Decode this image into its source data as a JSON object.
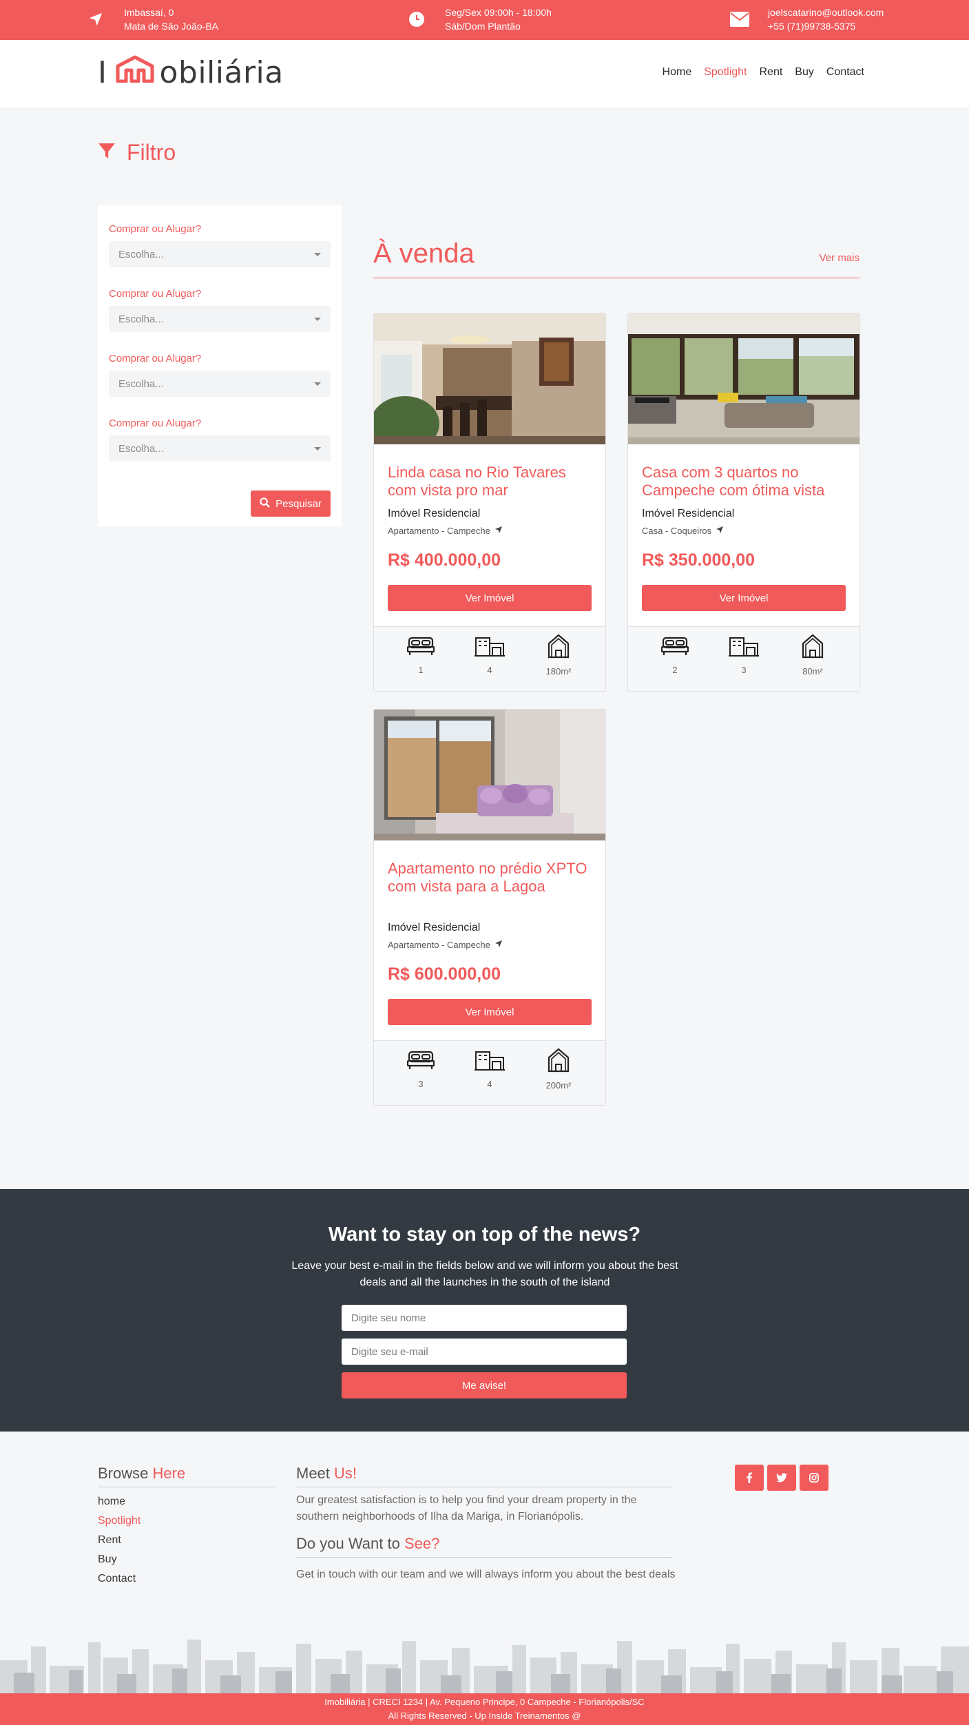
{
  "topbar": {
    "address_line1": "Imbassaí, 0",
    "address_line2": "Mata de São João-BA",
    "hours_line1": "Seg/Sex 09:00h - 18:00h",
    "hours_line2": "Sáb/Dom Plantão",
    "email": "joelscatarino@outlook.com",
    "phone": "+55 (71)99738-5375"
  },
  "brand": {
    "logo_start": "I",
    "logo_end": "obiliária"
  },
  "nav": {
    "home": "Home",
    "spotlight": "Spotlight",
    "rent": "Rent",
    "buy": "Buy",
    "contact": "Contact"
  },
  "filter": {
    "title": "Filtro",
    "groups": [
      {
        "label": "Comprar ou Alugar?",
        "placeholder": "Escolha..."
      },
      {
        "label": "Comprar ou Alugar?",
        "placeholder": "Escolha..."
      },
      {
        "label": "Comprar ou Alugar?",
        "placeholder": "Escolha..."
      },
      {
        "label": "Comprar ou Alugar?",
        "placeholder": "Escolha..."
      }
    ],
    "button": "Pesquisar"
  },
  "listing": {
    "title": "À venda",
    "more": "Ver mais",
    "cards": [
      {
        "title": "Linda casa no Rio Tavares com vista pro mar",
        "type": "Imóvel Residencial",
        "location": "Apartamento - Campeche",
        "price": "R$ 400.000,00",
        "button": "Ver Imóvel",
        "bedrooms": "1",
        "garage": "4",
        "area": "180m²"
      },
      {
        "title": "Casa com 3 quartos no Campeche com ótima vista",
        "type": "Imóvel Residencial",
        "location": "Casa - Coqueiros",
        "price": "R$ 350.000,00",
        "button": "Ver Imóvel",
        "bedrooms": "2",
        "garage": "3",
        "area": "80m²"
      },
      {
        "title": "Apartamento no prédio XPTO com vista para a Lagoa",
        "type": "Imóvel Residencial",
        "location": "Apartamento - Campeche",
        "price": "R$ 600.000,00",
        "button": "Ver Imóvel",
        "bedrooms": "3",
        "garage": "4",
        "area": "200m²"
      }
    ]
  },
  "newsletter": {
    "title": "Want to stay on top of the news?",
    "text": "Leave your best e-mail in the fields below and we will inform you about the best deals and all the launches in the south of the island",
    "name_placeholder": "Digite seu nome",
    "email_placeholder": "Digite seu e-mail",
    "button": "Me avise!"
  },
  "footer": {
    "browse_a": "Browse",
    "browse_b": "Here",
    "links": [
      "home",
      "Spotlight",
      "Rent",
      "Buy",
      "Contact"
    ],
    "meet_a": "Meet",
    "meet_b": "Us!",
    "meet_text": "Our greatest satisfaction is to help you find your dream property in the southern neighborhoods of Ilha da Mariga, in Florianópolis.",
    "see_a": "Do you Want to",
    "see_b": "See?",
    "see_text": "Get in touch with our team and we will always inform you about the best deals",
    "social": [
      "f",
      "t",
      "ig"
    ],
    "bottom_line1": "Imobiliária | CRECI 1234 | Av. Pequeno Principe, 0 Campeche - Florianópolis/SC",
    "bottom_line2": "All Rights Reserved - Up Inside Treinamentos @"
  },
  "colors": {
    "accent": "#f15a5a",
    "dark": "#343a42",
    "background": "#f5f6f8"
  },
  "icons": [
    "location-arrow-icon",
    "clock-icon",
    "envelope-icon",
    "filter-icon",
    "search-icon",
    "bed-icon",
    "garage-icon",
    "house-icon",
    "facebook-icon",
    "twitter-icon",
    "instagram-icon"
  ]
}
